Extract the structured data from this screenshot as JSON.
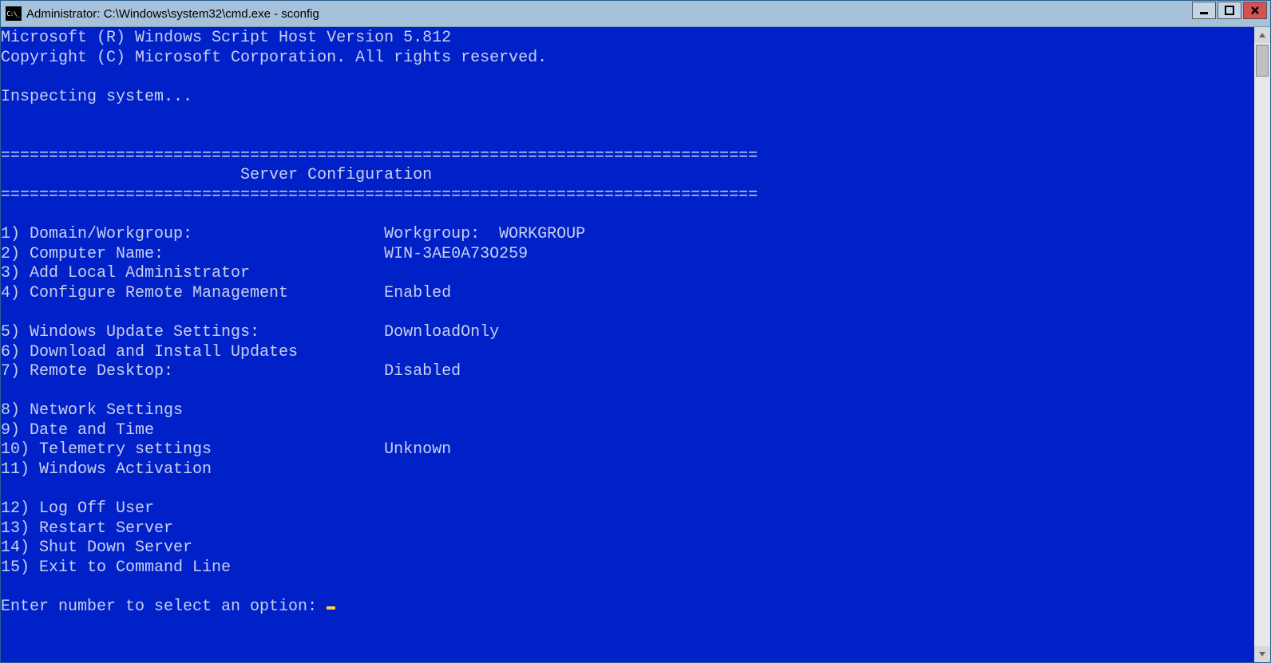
{
  "window": {
    "title": "Administrator: C:\\Windows\\system32\\cmd.exe - sconfig",
    "icon_text": "C:\\_"
  },
  "terminal": {
    "header1": "Microsoft (R) Windows Script Host Version 5.812",
    "header2": "Copyright (C) Microsoft Corporation. All rights reserved.",
    "inspecting": "Inspecting system...",
    "divider": "===============================================================================",
    "title": "                         Server Configuration",
    "menu": {
      "item1": "1) Domain/Workgroup:                    Workgroup:  WORKGROUP",
      "item2": "2) Computer Name:                       WIN-3AE0A73O259",
      "item3": "3) Add Local Administrator",
      "item4": "4) Configure Remote Management          Enabled",
      "item5": "5) Windows Update Settings:             DownloadOnly",
      "item6": "6) Download and Install Updates",
      "item7": "7) Remote Desktop:                      Disabled",
      "item8": "8) Network Settings",
      "item9": "9) Date and Time",
      "item10": "10) Telemetry settings                  Unknown",
      "item11": "11) Windows Activation",
      "item12": "12) Log Off User",
      "item13": "13) Restart Server",
      "item14": "14) Shut Down Server",
      "item15": "15) Exit to Command Line"
    },
    "prompt": "Enter number to select an option: "
  }
}
